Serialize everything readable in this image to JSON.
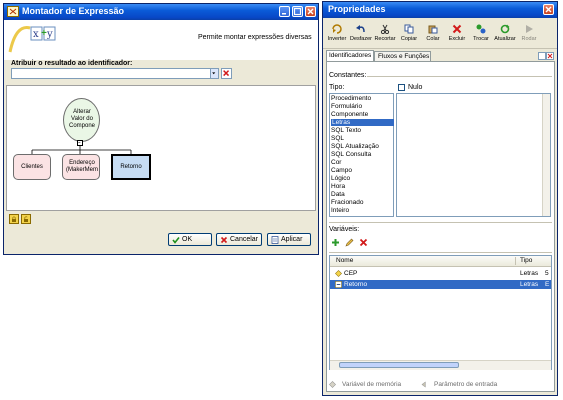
{
  "left_window": {
    "title": "Montador de Expressão",
    "description": "Permite montar expressões diversas",
    "logo_text": "x+y",
    "assign_label": "Atribuir o resultado ao identificador:",
    "assign_value": "",
    "diagram": {
      "root": "Alterar Valor do Compone",
      "children": [
        "Clientes",
        "Endereço (MakerMem",
        "Retorno"
      ]
    },
    "buttons": {
      "ok": "OK",
      "cancel": "Cancelar",
      "apply": "Aplicar"
    }
  },
  "right_window": {
    "title": "Propriedades",
    "toolbar": [
      "Inverter",
      "Desfazer",
      "Recortar",
      "Copiar",
      "Colar",
      "Excluir",
      "Trocar",
      "Atualizar",
      "Rodar"
    ],
    "tabs": [
      "Identificadores",
      "Fluxos e Funções"
    ],
    "constants_label": "Constantes:",
    "type_label": "Tipo:",
    "null_label": "Nulo",
    "types": [
      "Procedimento",
      "Formulário",
      "Componente",
      "Letras",
      "SQL Texto",
      "SQL",
      "SQL Atualização",
      "SQL Consulta",
      "Cor",
      "Campo",
      "Lógico",
      "Hora",
      "Data",
      "Fracionado",
      "Inteiro"
    ],
    "selected_type": "Letras",
    "variables_label": "Variáveis:",
    "variables_table": {
      "columns": [
        "Nome",
        "Tipo"
      ],
      "rows": [
        {
          "name": "CEP",
          "type": "Letras",
          "extra": "5"
        },
        {
          "name": "Retorno",
          "type": "Letras",
          "extra": "E"
        }
      ]
    },
    "footer": {
      "memory_var": "Variável de memória",
      "input_param": "Parâmetro de entrada"
    }
  },
  "colors": {
    "titlebar": "#0a5bd8",
    "window_bg": "#ece9d8",
    "selection": "#316ac5",
    "node_pink": "#fbe3e4",
    "node_green": "#eaf7e6",
    "node_blue": "#c6dcf3"
  }
}
